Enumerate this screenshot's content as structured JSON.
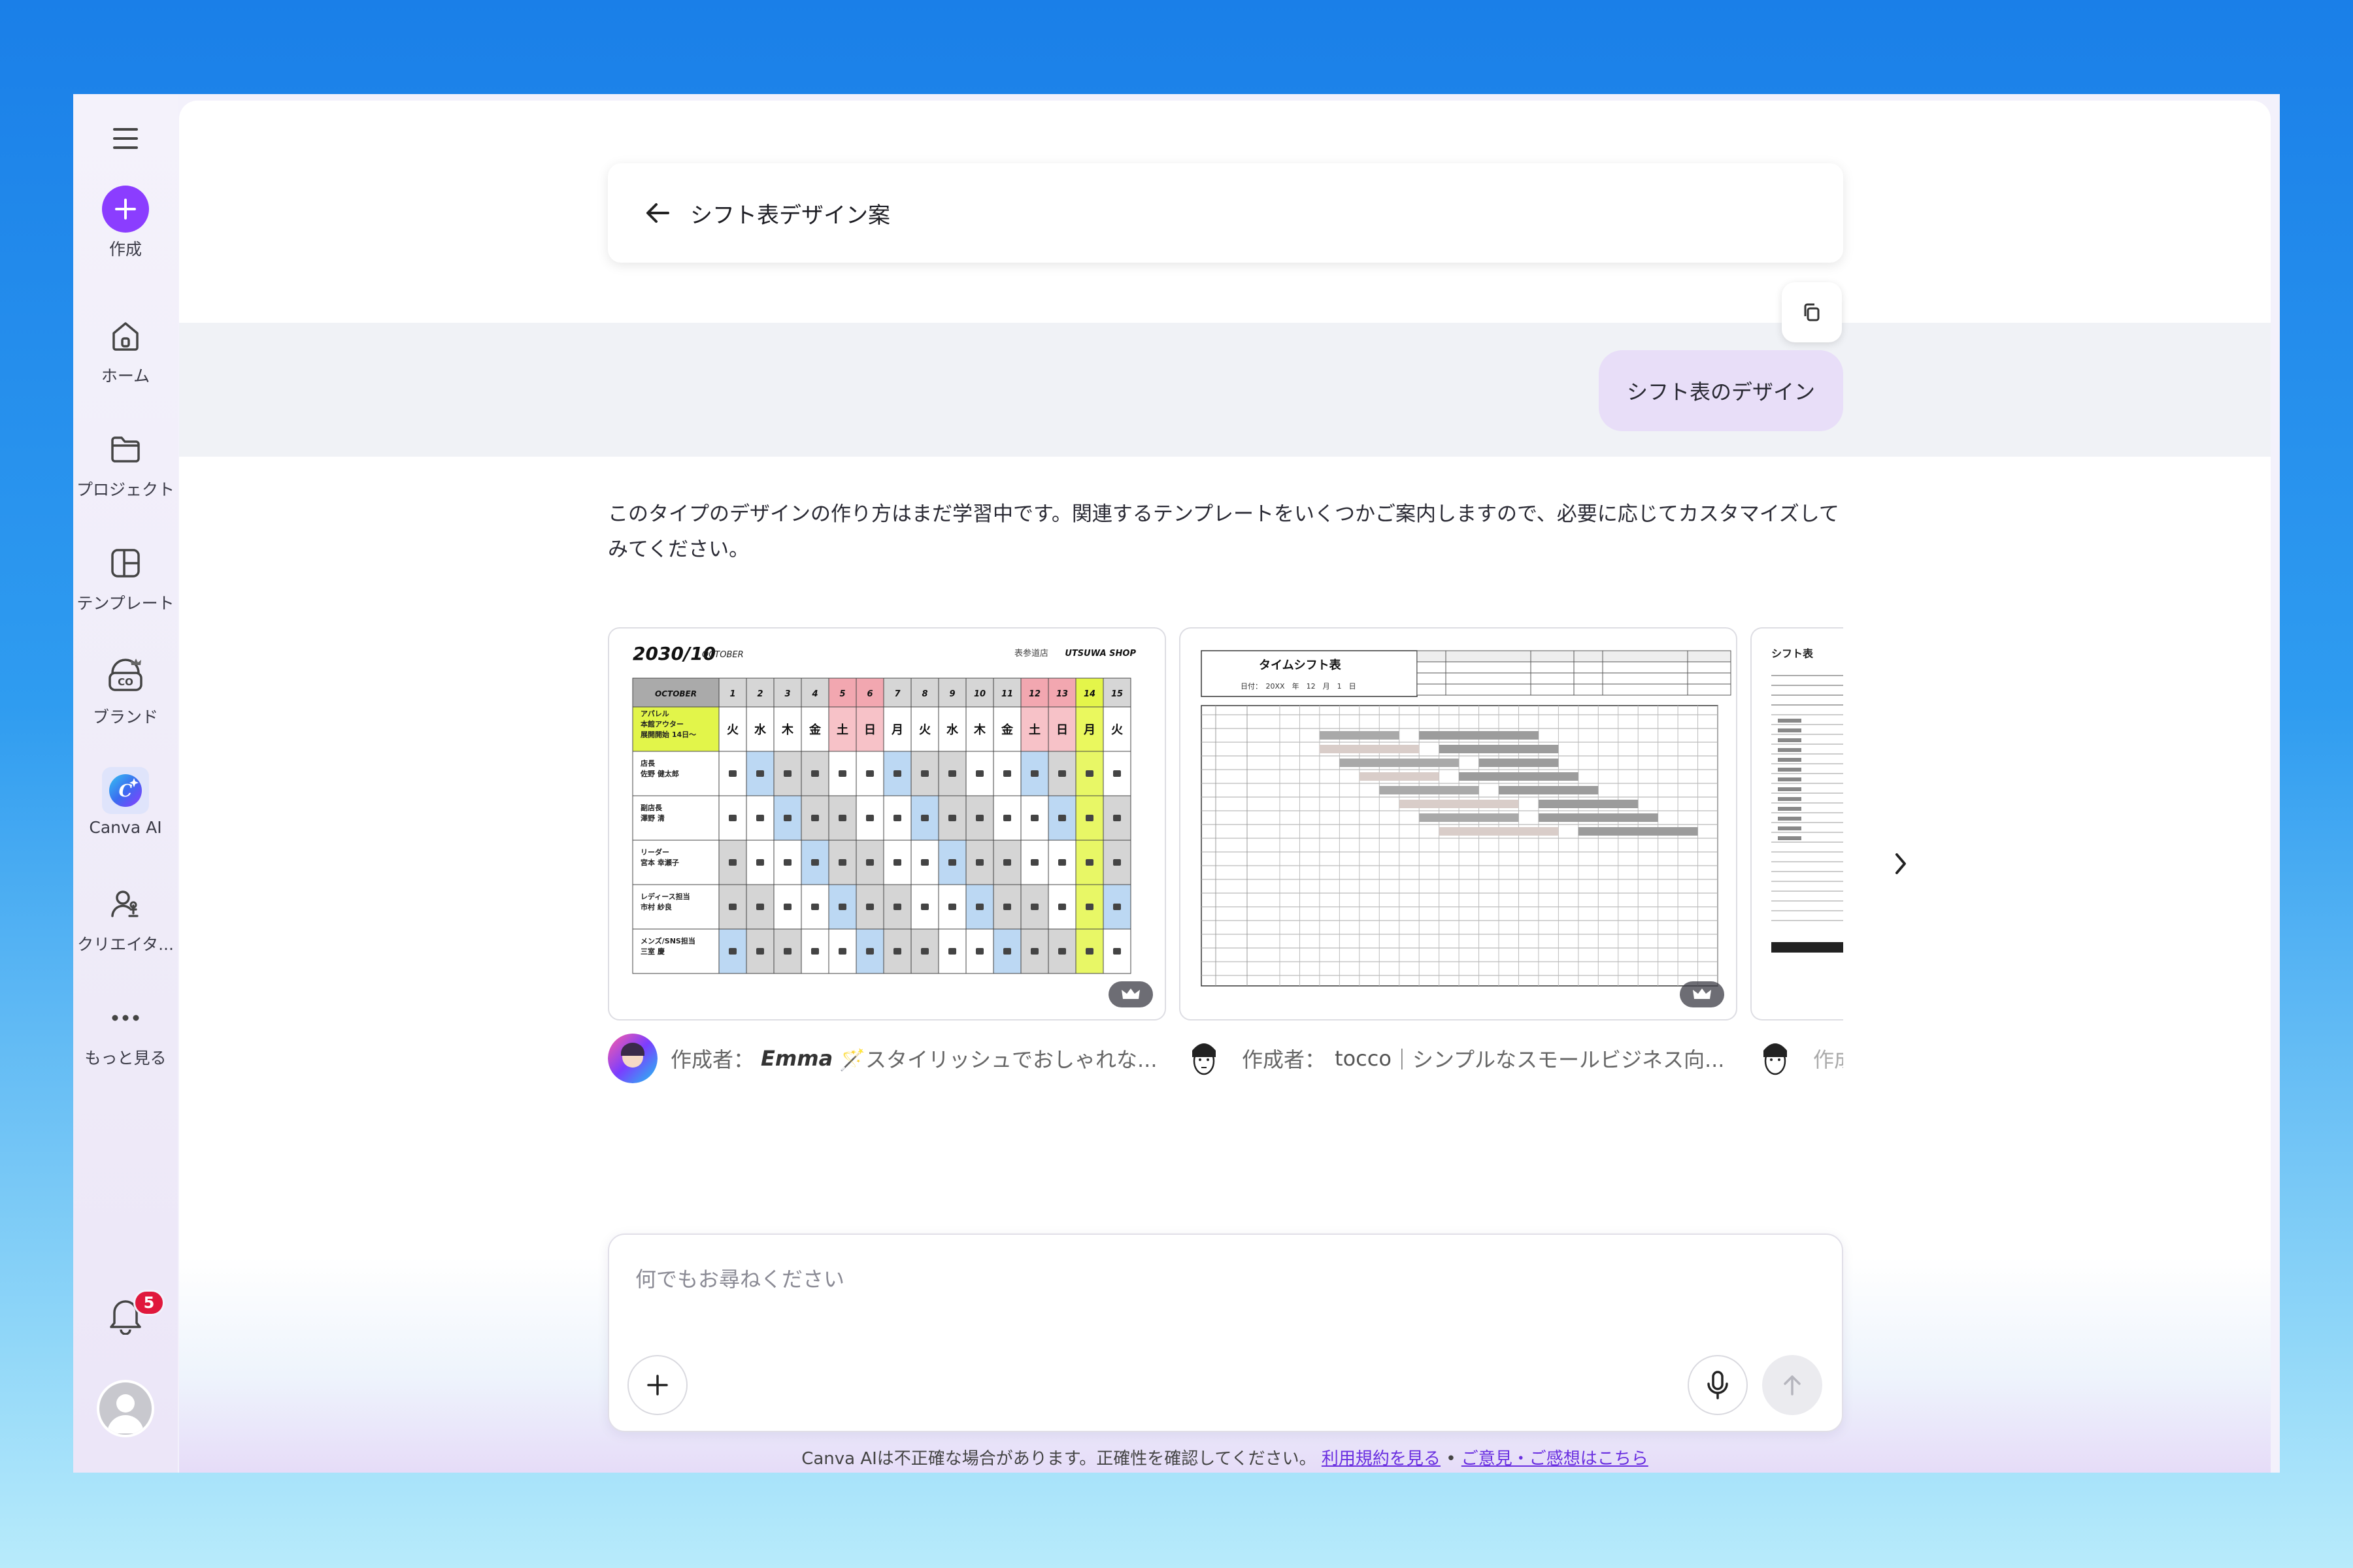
{
  "sidebar": {
    "items": [
      {
        "label": "作成"
      },
      {
        "label": "ホーム"
      },
      {
        "label": "プロジェクト"
      },
      {
        "label": "テンプレート"
      },
      {
        "label": "ブランド"
      },
      {
        "label": "Canva AI"
      },
      {
        "label": "クリエイタ..."
      },
      {
        "label": "もっと見る"
      }
    ],
    "notification_count": "5"
  },
  "header": {
    "title": "シフト表デザイン案"
  },
  "user_message": "シフト表のデザイン",
  "assistant_reply": "このタイプのデザインの作り方はまだ学習中です。関連するテンプレートをいくつかご案内しますので、必要に応じてカスタマイズしてみてください。",
  "templates": [
    {
      "author_prefix": "作成者：",
      "author": "Emma",
      "desc": "🪄スタイリッシュでおしゃれな...",
      "preview": {
        "title": "2030/10",
        "month": "OCTOBER",
        "store": "表参道店",
        "shop": "UTSUWA SHOP",
        "corner": "OCTOBER",
        "days": [
          "1",
          "2",
          "3",
          "4",
          "5",
          "6",
          "7",
          "8",
          "9",
          "10",
          "11",
          "12",
          "13",
          "14",
          "15"
        ],
        "weekdays": [
          "火",
          "水",
          "木",
          "金",
          "土",
          "日",
          "月",
          "火",
          "水",
          "木",
          "金",
          "土",
          "日",
          "月",
          "火"
        ],
        "roles": [
          "アパレル\n本館アウター\n展開開始 14日〜",
          "店長\n佐野 健太郎",
          "副店長\n澤野 清",
          "リーダー\n宮本 幸瀬子",
          "レディース担当\n市村 紗良",
          "メンズ/SNS担当\n三室 慶"
        ]
      }
    },
    {
      "author_prefix": "作成者：",
      "author": "tocco",
      "desc": "｜シンプルなスモールビジネス向...",
      "preview": {
        "title": "タイムシフト表",
        "date": "日付：　20XX　年　12　月　1　日"
      }
    },
    {
      "author_prefix": "作成",
      "author": "",
      "desc": "",
      "preview": {
        "title": "シフト表"
      }
    }
  ],
  "composer": {
    "placeholder": "何でもお尋ねください"
  },
  "disclaimer": {
    "text": "Canva AIは不正確な場合があります。正確性を確認してください。",
    "terms_link": "利用規約を見る",
    "separator": "•",
    "feedback_link": "ご意見・ご感想はこちら"
  },
  "colors": {
    "brand_purple": "#8b3dff",
    "bubble": "#e8def8",
    "background_top": "#1a7fe8"
  }
}
